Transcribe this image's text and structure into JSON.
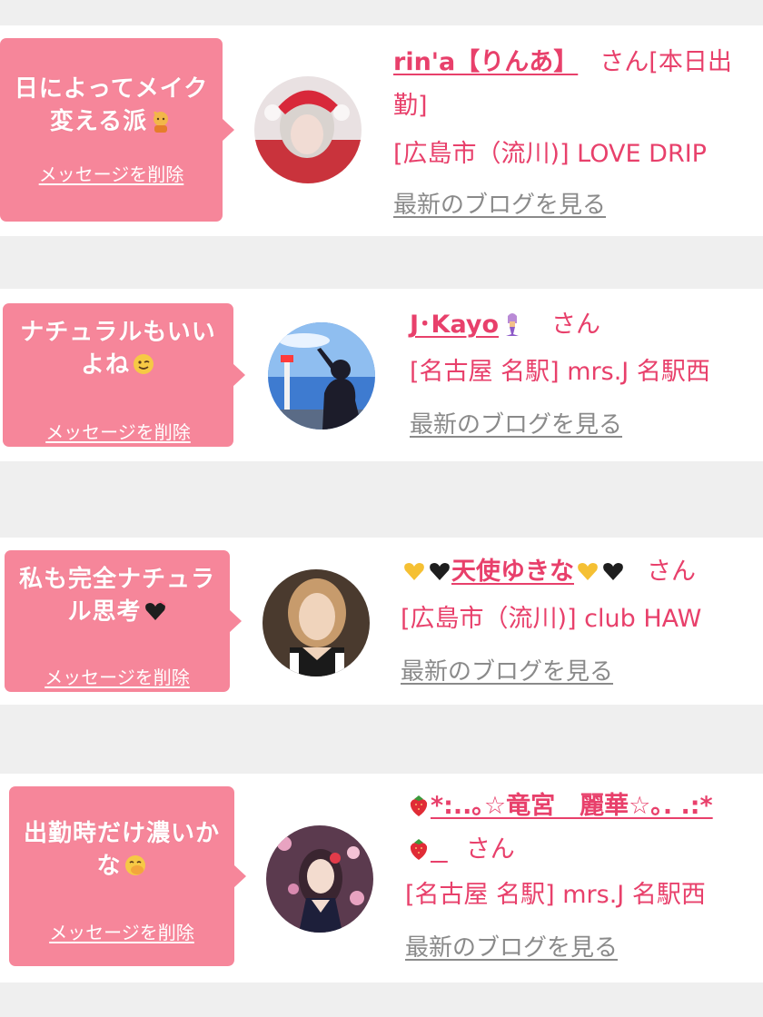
{
  "common": {
    "delete_label": "メッセージを削除",
    "blog_label": "最新のブログを見る",
    "san": "さん"
  },
  "colors": {
    "accent": "#e8406b",
    "bubble": "#f6869a",
    "link_gray": "#8a8a8a",
    "background": "#efefef"
  },
  "messages": [
    {
      "bubble_line1": "日によってメイク",
      "bubble_line2": "変える派",
      "bubble_emoji": "person-raising-hand-emoji",
      "name": "rin'a【りんあ】",
      "san_suffix": "さん[本日出",
      "san_suffix2": "勤]",
      "shop": "[広島市（流川)] LOVE DRIP"
    },
    {
      "bubble_line1": "ナチュラルもいい",
      "bubble_line2": "よね",
      "bubble_emoji": "winking-face-emoji",
      "name": "J･Kayo",
      "name_emoji": "mermaid-emoji",
      "shop": "[名古屋 名駅] mrs.J 名駅西"
    },
    {
      "bubble_line1": "私も完全ナチュラ",
      "bubble_line2": "ル思考",
      "bubble_emoji": "black-heart-emoji",
      "name": "天使ゆきな",
      "shop": "[広島市（流川)] club HAW"
    },
    {
      "bubble_line1": "出勤時だけ濃いか",
      "bubble_line2": "な",
      "bubble_emoji": "hand-over-mouth-emoji",
      "name": "*:..｡☆竜宮　麗華☆｡. .:*",
      "shop": "[名古屋 名駅] mrs.J 名駅西"
    }
  ]
}
